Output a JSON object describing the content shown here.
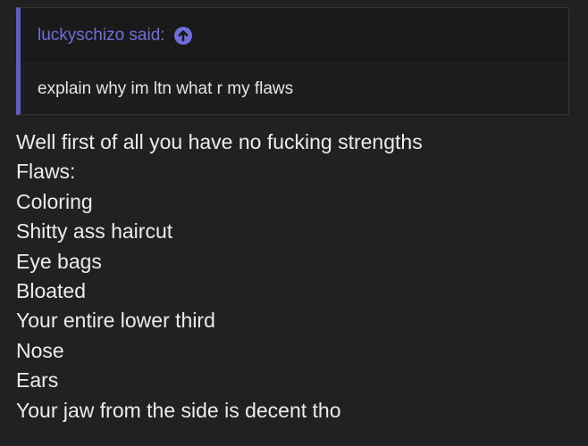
{
  "quote": {
    "author_label": "luckyschizo said:",
    "jump_icon": "up-arrow-circle-icon",
    "text": "explain why im ltn what r my flaws"
  },
  "reply": {
    "lines": [
      "Well first of all you have no fucking strengths",
      "Flaws:",
      "Coloring",
      "Shitty ass haircut",
      "Eye bags",
      "Bloated",
      "Your entire lower third",
      "Nose",
      "Ears",
      "Your jaw from the side is decent tho"
    ]
  },
  "colors": {
    "background": "#212121",
    "quote_accent": "#5b5ec7",
    "author_link": "#6d70dc",
    "text": "#ececec"
  }
}
